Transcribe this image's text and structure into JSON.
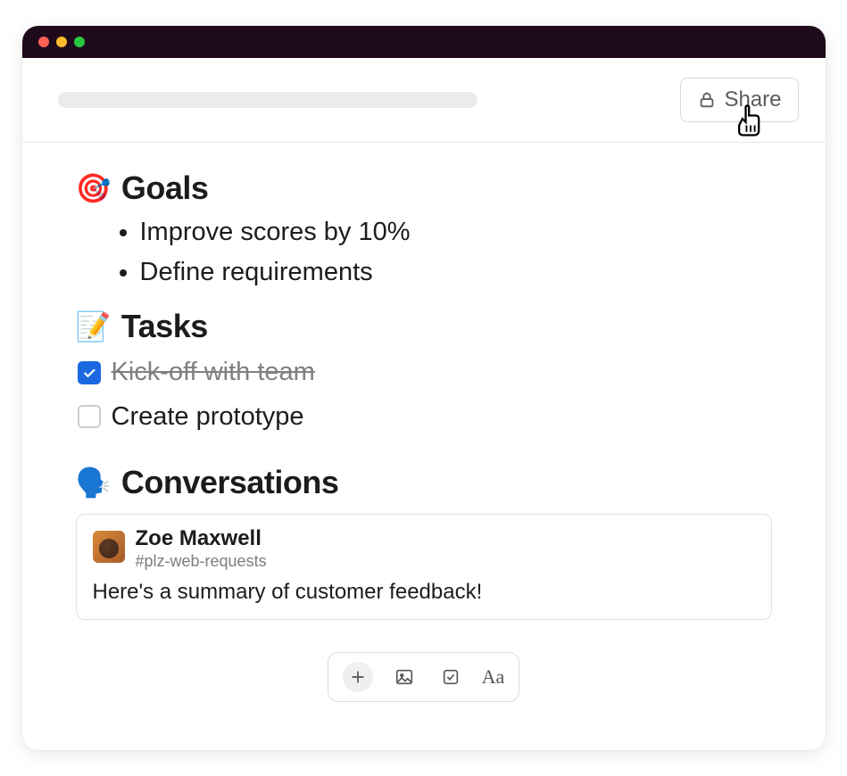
{
  "header": {
    "share_label": "Share"
  },
  "sections": {
    "goals": {
      "emoji": "🎯",
      "title": "Goals",
      "items": [
        "Improve scores by 10%",
        "Define requirements"
      ]
    },
    "tasks": {
      "emoji": "📝",
      "title": "Tasks",
      "items": [
        {
          "label": "Kick-off with team",
          "checked": true
        },
        {
          "label": "Create prototype",
          "checked": false
        }
      ]
    },
    "conversations": {
      "emoji": "🗣️",
      "title": "Conversations",
      "card": {
        "author": "Zoe Maxwell",
        "channel": "#plz-web-requests",
        "message": "Here's a summary of customer feedback!"
      }
    }
  },
  "toolbar": {
    "text_format_label": "Aa"
  }
}
